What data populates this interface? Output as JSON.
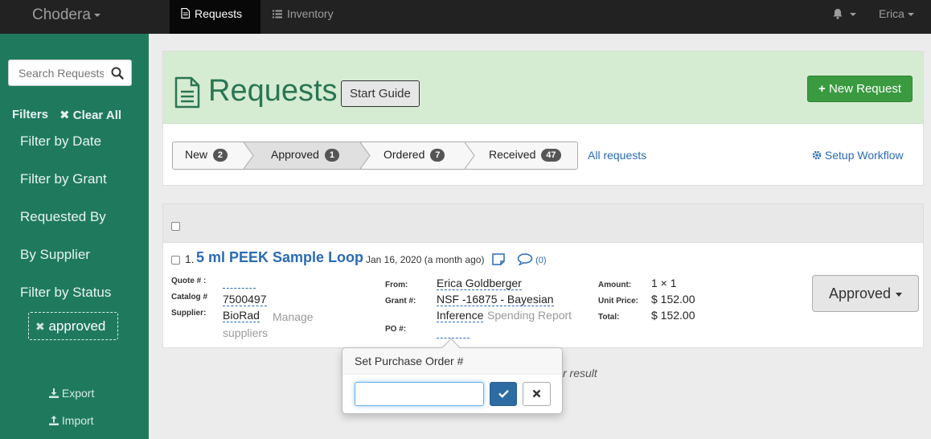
{
  "navbar": {
    "brand": "Chodera",
    "tabs": [
      {
        "label": "Requests",
        "icon": "document-icon",
        "active": true
      },
      {
        "label": "Inventory",
        "icon": "list-icon",
        "active": false
      }
    ],
    "user": "Erica",
    "bell_icon": "bell-icon"
  },
  "sidebar": {
    "search_placeholder": "Search Requests",
    "filters_label": "Filters",
    "clear_all_label": "Clear All",
    "items": [
      "Filter by Date",
      "Filter by Grant",
      "Requested By",
      "By Supplier",
      "Filter by Status"
    ],
    "active_status_tag": "approved",
    "export_label": "Export",
    "import_label": "Import"
  },
  "header": {
    "title": "Requests",
    "start_guide_label": "Start Guide",
    "new_request_label": "New Request",
    "pipeline": [
      {
        "label": "New",
        "count": "2"
      },
      {
        "label": "Approved",
        "count": "1"
      },
      {
        "label": "Ordered",
        "count": "7"
      },
      {
        "label": "Received",
        "count": "47"
      }
    ],
    "all_requests_label": "All requests",
    "setup_workflow_label": "Setup Workflow"
  },
  "request": {
    "number": "1.",
    "title": "5 ml PEEK Sample Loop",
    "date": "Jan 16, 2020 (a month ago)",
    "comments": "(0)",
    "quote_label": "Quote # :",
    "catalog_label": "Catalog #",
    "catalog_value": "7500497",
    "supplier_label": "Supplier:",
    "supplier_value": "BioRad",
    "manage_suppliers": "Manage suppliers",
    "from_label": "From:",
    "from_value": "Erica Goldberger",
    "grant_label": "Grant #:",
    "grant_value_line1": "NSF -16875 - Bayesian",
    "grant_value_line2": "Inference",
    "spending_report": "Spending Report",
    "po_label": "PO #:",
    "amount_label": "Amount:",
    "amount_value": "1  ×  1",
    "unit_price_label": "Unit Price:",
    "unit_price_value": "$ 152.00",
    "total_label": "Total:",
    "total_value": "$ 152.00",
    "status_button": "Approved"
  },
  "popover": {
    "title": "Set Purchase Order #",
    "input_value": "",
    "ok_icon": "check-icon",
    "cancel_icon": "close-icon"
  },
  "footer_result": "r result",
  "colors": {
    "sidebar_bg": "#1f7a5d",
    "header_bg": "#d6ecd2",
    "title_green": "#2a7554",
    "new_request_green": "#3a9a3f",
    "link_blue": "#2a6ab3",
    "primary_blue": "#2d6ca2"
  }
}
